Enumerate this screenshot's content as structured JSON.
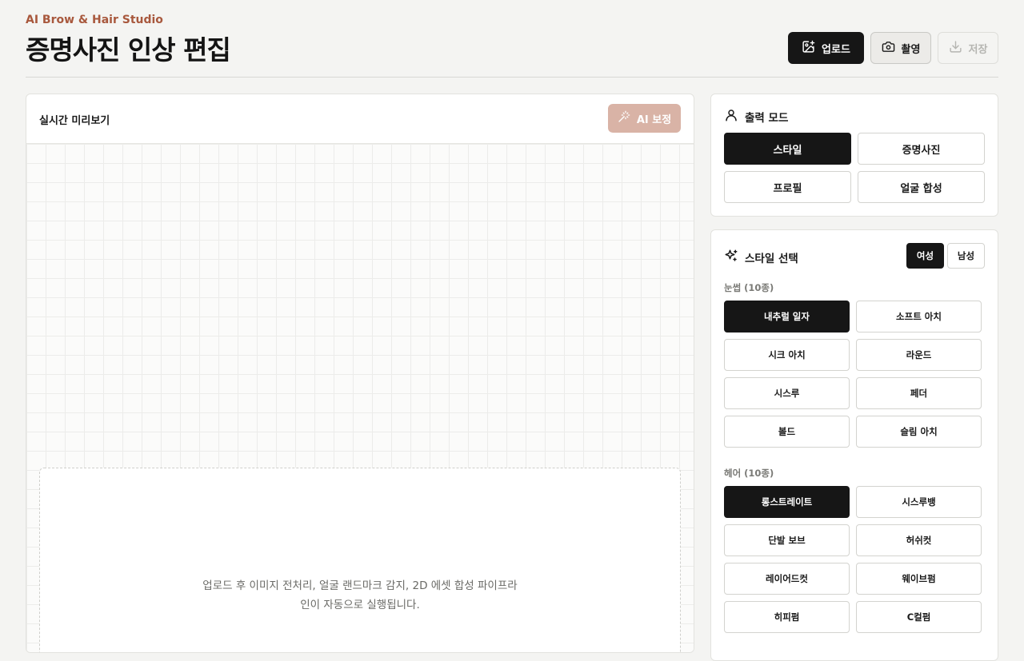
{
  "header": {
    "brand": "AI Brow & Hair Studio",
    "title": "증명사진 인상 편집",
    "upload_label": "업로드",
    "capture_label": "촬영",
    "save_label": "저장"
  },
  "preview": {
    "title": "실시간 미리보기",
    "ai_label": "AI 보정",
    "drop_text": "업로드 후 이미지 전처리, 얼굴 랜드마크 감지, 2D 에셋 합성 파이프라인이 자동으로 실행됩니다."
  },
  "mode": {
    "title": "출력 모드",
    "options": [
      "스타일",
      "증명사진",
      "프로필",
      "얼굴 합성"
    ],
    "selected": "스타일"
  },
  "style": {
    "title": "스타일 선택",
    "gender_female": "여성",
    "gender_male": "남성",
    "gender_selected": "여성",
    "brow_label": "눈썹 (10종)",
    "brows": [
      "내추럴 일자",
      "소프트 아치",
      "시크 아치",
      "라운드",
      "시스루",
      "페더",
      "볼드",
      "슬림 아치"
    ],
    "brow_selected": "내추럴 일자",
    "hair_label": "헤어 (10종)",
    "hairs": [
      "롱스트레이트",
      "시스루뱅",
      "단발 보브",
      "허쉬컷",
      "레이어드컷",
      "웨이브펌",
      "히피펌",
      "C컬펌"
    ],
    "hair_selected": "롱스트레이트"
  },
  "colors": {
    "accent": "#a8583d",
    "primary": "#161616",
    "ai_button": "#d9b3a6",
    "background": "#f4f4f2"
  },
  "icons": {
    "upload": "image-plus-icon",
    "capture": "camera-icon",
    "save": "download-icon",
    "ai": "magic-wand-icon",
    "mode": "user-icon",
    "style": "sparkles-icon"
  }
}
